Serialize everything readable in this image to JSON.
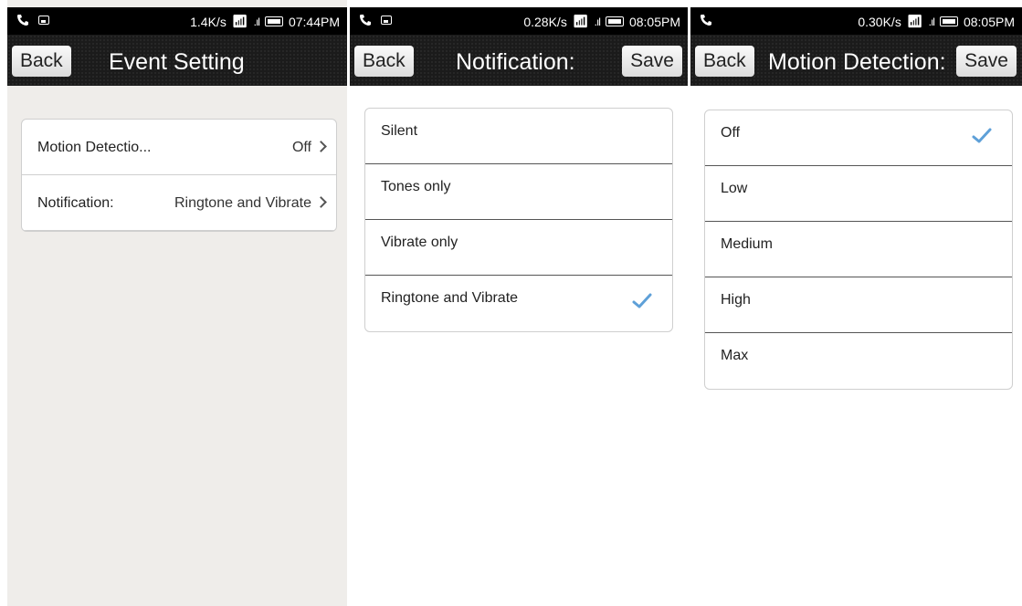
{
  "screens": [
    {
      "status": {
        "speed": "1.4K/s",
        "time": "07:44PM"
      },
      "back_label": "Back",
      "title": "Event Setting",
      "rows": [
        {
          "label": "Motion Detectio...",
          "value": "Off"
        },
        {
          "label": "Notification:",
          "value": "Ringtone and Vibrate"
        }
      ]
    },
    {
      "status": {
        "speed": "0.28K/s",
        "time": "08:05PM"
      },
      "back_label": "Back",
      "title": "Notification:",
      "save_label": "Save",
      "options": [
        "Silent",
        "Tones only",
        "Vibrate only",
        "Ringtone and Vibrate"
      ],
      "selected": "Ringtone and Vibrate"
    },
    {
      "status": {
        "speed": "0.30K/s",
        "time": "08:05PM"
      },
      "back_label": "Back",
      "title": "Motion Detection:",
      "save_label": "Save",
      "options": [
        "Off",
        "Low",
        "Medium",
        "High",
        "Max"
      ],
      "selected": "Off"
    }
  ],
  "colors": {
    "check": "#5ea0d8",
    "titlebar": "#1b1b1b",
    "settings_bg": "#efedea"
  },
  "icons": [
    "phone-icon",
    "image-icon",
    "wifi-icon",
    "signal-icon",
    "battery-icon",
    "chevron-right-icon",
    "checkmark-icon"
  ]
}
